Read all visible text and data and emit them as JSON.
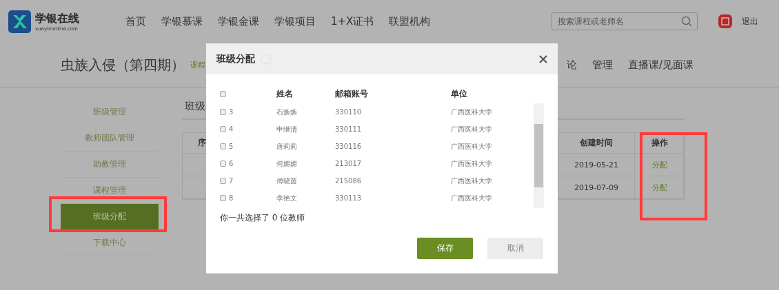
{
  "header": {
    "logo": {
      "name": "学银在线",
      "domain": "xueyinonline.com"
    },
    "nav": [
      "首页",
      "学银慕课",
      "学银金课",
      "学银项目",
      "1+X证书",
      "联盟机构"
    ],
    "search": {
      "placeholder": "搜索课程或老师名"
    },
    "logout": "退出"
  },
  "course": {
    "title": "虫族入侵（第四期）",
    "tag": "课程",
    "tabs": [
      "论",
      "管理",
      "直播课/见面课"
    ]
  },
  "sidebar": {
    "items": [
      {
        "label": "班级管理",
        "selected": false
      },
      {
        "label": "教师团队管理",
        "selected": false
      },
      {
        "label": "助教管理",
        "selected": false
      },
      {
        "label": "课程管理",
        "selected": false
      },
      {
        "label": "班级分配",
        "selected": true
      },
      {
        "label": "下载中心",
        "selected": false
      }
    ]
  },
  "content": {
    "heading": "班级",
    "table": {
      "columns": [
        "序",
        "创建时间",
        "操作"
      ],
      "rows": [
        {
          "created": "2019-05-21",
          "action": "分配"
        },
        {
          "created": "2019-07-09",
          "action": "分配"
        }
      ]
    }
  },
  "modal": {
    "title": "班级分配",
    "select_all": false,
    "columns": [
      "姓名",
      "邮箱账号",
      "单位"
    ],
    "rows": [
      {
        "checked": false,
        "index": "3",
        "name": "石焕焕",
        "email": "330110",
        "unit": "广西医科大学"
      },
      {
        "checked": false,
        "index": "4",
        "name": "申继清",
        "email": "330111",
        "unit": "广西医科大学"
      },
      {
        "checked": false,
        "index": "5",
        "name": "唐莉莉",
        "email": "330116",
        "unit": "广西医科大学"
      },
      {
        "checked": false,
        "index": "6",
        "name": "何媚媚",
        "email": "213017",
        "unit": "广西医科大学"
      },
      {
        "checked": false,
        "index": "7",
        "name": "傅晓茵",
        "email": "215086",
        "unit": "广西医科大学"
      },
      {
        "checked": false,
        "index": "8",
        "name": "李艳文",
        "email": "330113",
        "unit": "广西医科大学"
      }
    ],
    "summary": "你一共选择了 0 位教师",
    "buttons": [
      {
        "label": "保存",
        "kind": "primary"
      },
      {
        "label": "取消",
        "kind": "secondary"
      }
    ]
  }
}
